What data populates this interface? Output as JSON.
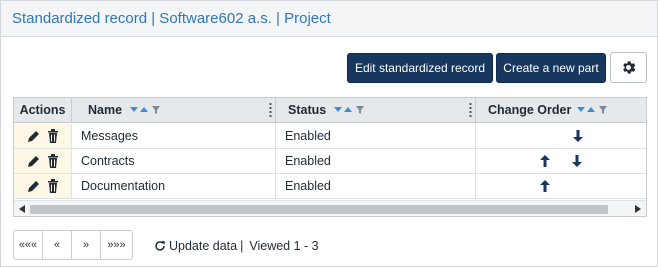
{
  "panel": {
    "title": "Standardized record | Software602 a.s. | Project"
  },
  "toolbar": {
    "edit_label": "Edit standardized record",
    "create_label": "Create a new part",
    "settings_icon": "gear-icon"
  },
  "grid": {
    "columns": [
      "Actions",
      "Name",
      "Status",
      "Change Order"
    ],
    "rows": [
      {
        "name": "Messages",
        "status": "Enabled",
        "order": {
          "up": false,
          "down": true
        }
      },
      {
        "name": "Contracts",
        "status": "Enabled",
        "order": {
          "up": true,
          "down": true
        }
      },
      {
        "name": "Documentation",
        "status": "Enabled",
        "order": {
          "up": true,
          "down": false
        }
      }
    ]
  },
  "pager": {
    "first": "«««",
    "prev": "«",
    "next": "»",
    "last": "»»»"
  },
  "footer": {
    "update_label": "Update data",
    "separator": "|",
    "viewed_label": "Viewed 1 - 3"
  },
  "colors": {
    "accent": "#2e77b8",
    "primary_button": "#17375e",
    "arrow": "#17375e",
    "sort_icon": "#3a8fd6"
  }
}
